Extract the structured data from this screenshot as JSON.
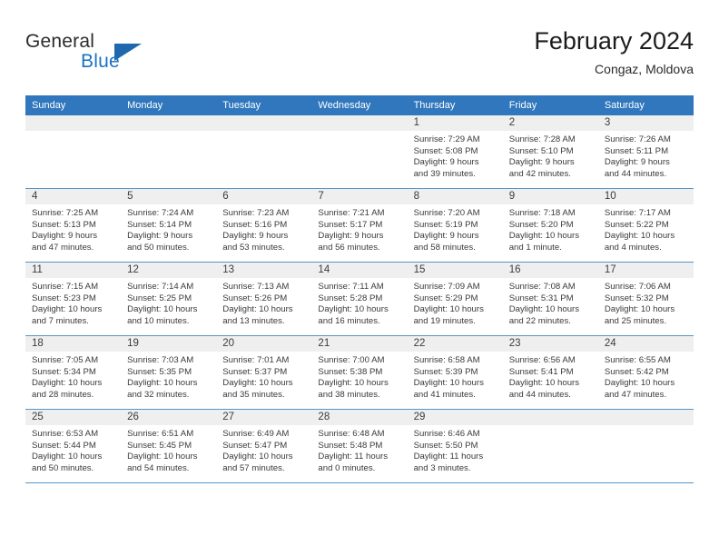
{
  "brand": {
    "name_part1": "General",
    "name_part2": "Blue",
    "logo_icon": "triangle-logo-icon"
  },
  "header": {
    "month_title": "February 2024",
    "location": "Congaz, Moldova"
  },
  "calendar": {
    "weekday_headers": [
      "Sunday",
      "Monday",
      "Tuesday",
      "Wednesday",
      "Thursday",
      "Friday",
      "Saturday"
    ],
    "accent_color": "#3077bd",
    "daynum_band_color": "#efefef",
    "row_separator_color": "#5a93c7",
    "weeks": [
      [
        {
          "day": "",
          "lines": []
        },
        {
          "day": "",
          "lines": []
        },
        {
          "day": "",
          "lines": []
        },
        {
          "day": "",
          "lines": []
        },
        {
          "day": "1",
          "lines": [
            "Sunrise: 7:29 AM",
            "Sunset: 5:08 PM",
            "Daylight: 9 hours",
            "and 39 minutes."
          ]
        },
        {
          "day": "2",
          "lines": [
            "Sunrise: 7:28 AM",
            "Sunset: 5:10 PM",
            "Daylight: 9 hours",
            "and 42 minutes."
          ]
        },
        {
          "day": "3",
          "lines": [
            "Sunrise: 7:26 AM",
            "Sunset: 5:11 PM",
            "Daylight: 9 hours",
            "and 44 minutes."
          ]
        }
      ],
      [
        {
          "day": "4",
          "lines": [
            "Sunrise: 7:25 AM",
            "Sunset: 5:13 PM",
            "Daylight: 9 hours",
            "and 47 minutes."
          ]
        },
        {
          "day": "5",
          "lines": [
            "Sunrise: 7:24 AM",
            "Sunset: 5:14 PM",
            "Daylight: 9 hours",
            "and 50 minutes."
          ]
        },
        {
          "day": "6",
          "lines": [
            "Sunrise: 7:23 AM",
            "Sunset: 5:16 PM",
            "Daylight: 9 hours",
            "and 53 minutes."
          ]
        },
        {
          "day": "7",
          "lines": [
            "Sunrise: 7:21 AM",
            "Sunset: 5:17 PM",
            "Daylight: 9 hours",
            "and 56 minutes."
          ]
        },
        {
          "day": "8",
          "lines": [
            "Sunrise: 7:20 AM",
            "Sunset: 5:19 PM",
            "Daylight: 9 hours",
            "and 58 minutes."
          ]
        },
        {
          "day": "9",
          "lines": [
            "Sunrise: 7:18 AM",
            "Sunset: 5:20 PM",
            "Daylight: 10 hours",
            "and 1 minute."
          ]
        },
        {
          "day": "10",
          "lines": [
            "Sunrise: 7:17 AM",
            "Sunset: 5:22 PM",
            "Daylight: 10 hours",
            "and 4 minutes."
          ]
        }
      ],
      [
        {
          "day": "11",
          "lines": [
            "Sunrise: 7:15 AM",
            "Sunset: 5:23 PM",
            "Daylight: 10 hours",
            "and 7 minutes."
          ]
        },
        {
          "day": "12",
          "lines": [
            "Sunrise: 7:14 AM",
            "Sunset: 5:25 PM",
            "Daylight: 10 hours",
            "and 10 minutes."
          ]
        },
        {
          "day": "13",
          "lines": [
            "Sunrise: 7:13 AM",
            "Sunset: 5:26 PM",
            "Daylight: 10 hours",
            "and 13 minutes."
          ]
        },
        {
          "day": "14",
          "lines": [
            "Sunrise: 7:11 AM",
            "Sunset: 5:28 PM",
            "Daylight: 10 hours",
            "and 16 minutes."
          ]
        },
        {
          "day": "15",
          "lines": [
            "Sunrise: 7:09 AM",
            "Sunset: 5:29 PM",
            "Daylight: 10 hours",
            "and 19 minutes."
          ]
        },
        {
          "day": "16",
          "lines": [
            "Sunrise: 7:08 AM",
            "Sunset: 5:31 PM",
            "Daylight: 10 hours",
            "and 22 minutes."
          ]
        },
        {
          "day": "17",
          "lines": [
            "Sunrise: 7:06 AM",
            "Sunset: 5:32 PM",
            "Daylight: 10 hours",
            "and 25 minutes."
          ]
        }
      ],
      [
        {
          "day": "18",
          "lines": [
            "Sunrise: 7:05 AM",
            "Sunset: 5:34 PM",
            "Daylight: 10 hours",
            "and 28 minutes."
          ]
        },
        {
          "day": "19",
          "lines": [
            "Sunrise: 7:03 AM",
            "Sunset: 5:35 PM",
            "Daylight: 10 hours",
            "and 32 minutes."
          ]
        },
        {
          "day": "20",
          "lines": [
            "Sunrise: 7:01 AM",
            "Sunset: 5:37 PM",
            "Daylight: 10 hours",
            "and 35 minutes."
          ]
        },
        {
          "day": "21",
          "lines": [
            "Sunrise: 7:00 AM",
            "Sunset: 5:38 PM",
            "Daylight: 10 hours",
            "and 38 minutes."
          ]
        },
        {
          "day": "22",
          "lines": [
            "Sunrise: 6:58 AM",
            "Sunset: 5:39 PM",
            "Daylight: 10 hours",
            "and 41 minutes."
          ]
        },
        {
          "day": "23",
          "lines": [
            "Sunrise: 6:56 AM",
            "Sunset: 5:41 PM",
            "Daylight: 10 hours",
            "and 44 minutes."
          ]
        },
        {
          "day": "24",
          "lines": [
            "Sunrise: 6:55 AM",
            "Sunset: 5:42 PM",
            "Daylight: 10 hours",
            "and 47 minutes."
          ]
        }
      ],
      [
        {
          "day": "25",
          "lines": [
            "Sunrise: 6:53 AM",
            "Sunset: 5:44 PM",
            "Daylight: 10 hours",
            "and 50 minutes."
          ]
        },
        {
          "day": "26",
          "lines": [
            "Sunrise: 6:51 AM",
            "Sunset: 5:45 PM",
            "Daylight: 10 hours",
            "and 54 minutes."
          ]
        },
        {
          "day": "27",
          "lines": [
            "Sunrise: 6:49 AM",
            "Sunset: 5:47 PM",
            "Daylight: 10 hours",
            "and 57 minutes."
          ]
        },
        {
          "day": "28",
          "lines": [
            "Sunrise: 6:48 AM",
            "Sunset: 5:48 PM",
            "Daylight: 11 hours",
            "and 0 minutes."
          ]
        },
        {
          "day": "29",
          "lines": [
            "Sunrise: 6:46 AM",
            "Sunset: 5:50 PM",
            "Daylight: 11 hours",
            "and 3 minutes."
          ]
        },
        {
          "day": "",
          "lines": []
        },
        {
          "day": "",
          "lines": []
        }
      ]
    ]
  }
}
